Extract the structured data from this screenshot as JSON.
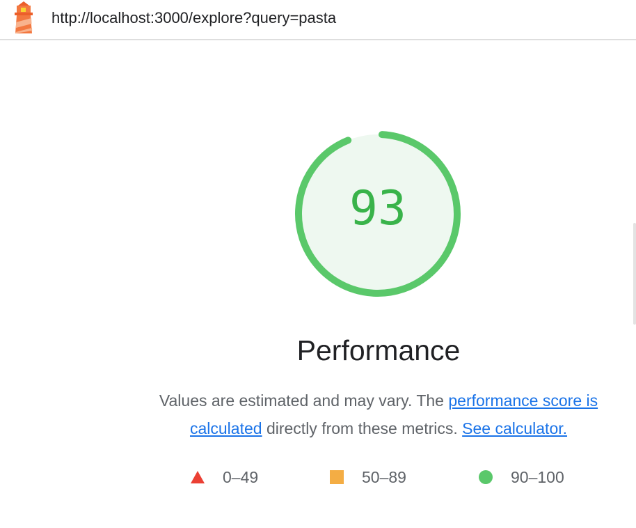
{
  "topbar": {
    "url": "http://localhost:3000/explore?query=pasta",
    "logo_icon": "lighthouse-icon"
  },
  "gauge": {
    "score": "93",
    "score_value": 93,
    "color": "#5ac86a",
    "fill_color": "#eef8f0",
    "text_color": "#39b34a"
  },
  "category": {
    "title": "Performance"
  },
  "description": {
    "text_before": "Values are estimated and may vary. The ",
    "link1": "performance score is calculated",
    "text_middle": " directly from these metrics. ",
    "link2": "See calculator."
  },
  "legend": {
    "items": [
      {
        "range": "0–49",
        "icon": "triangle-icon",
        "color": "#eb4034"
      },
      {
        "range": "50–89",
        "icon": "square-icon",
        "color": "#f4ad44"
      },
      {
        "range": "90–100",
        "icon": "circle-icon",
        "color": "#5ac86a"
      }
    ]
  }
}
